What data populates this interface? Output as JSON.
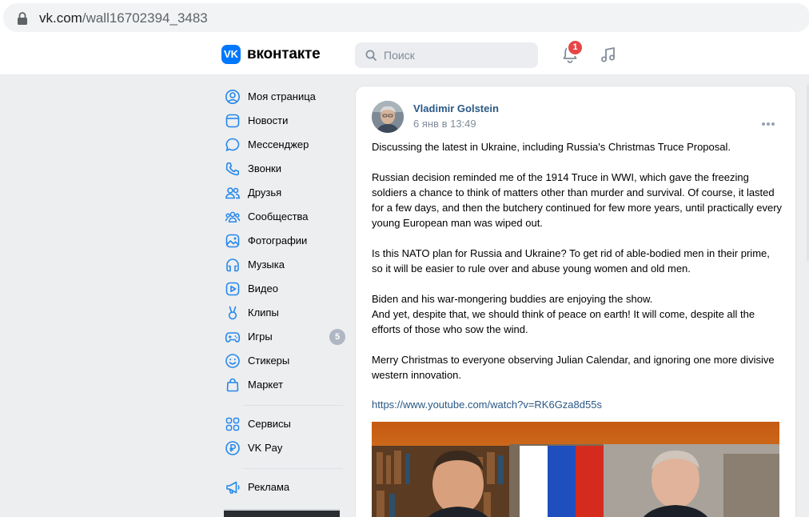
{
  "browser": {
    "url_host": "vk.com",
    "url_path": "/wall16702394_3483",
    "lock_icon": "lock-icon"
  },
  "header": {
    "logo_mark": "VK",
    "site_name": "вконтакте",
    "search_placeholder": "Поиск",
    "notifications_count": "1",
    "accent": "#0077ff",
    "badge_color": "#e64646"
  },
  "sidebar": {
    "items": [
      {
        "label": "Моя страница",
        "icon": "user-circle-icon"
      },
      {
        "label": "Новости",
        "icon": "news-icon"
      },
      {
        "label": "Мессенджер",
        "icon": "message-icon"
      },
      {
        "label": "Звонки",
        "icon": "phone-icon"
      },
      {
        "label": "Друзья",
        "icon": "friends-icon"
      },
      {
        "label": "Сообщества",
        "icon": "communities-icon"
      },
      {
        "label": "Фотографии",
        "icon": "photo-icon"
      },
      {
        "label": "Музыка",
        "icon": "music-icon"
      },
      {
        "label": "Видео",
        "icon": "video-icon"
      },
      {
        "label": "Клипы",
        "icon": "clips-icon"
      },
      {
        "label": "Игры",
        "icon": "games-icon",
        "count": "5"
      },
      {
        "label": "Стикеры",
        "icon": "smile-icon"
      },
      {
        "label": "Маркет",
        "icon": "market-bag-icon"
      }
    ],
    "items2": [
      {
        "label": "Сервисы",
        "icon": "services-grid-icon"
      },
      {
        "label": "VK Pay",
        "icon": "vkpay-icon"
      }
    ],
    "items3": [
      {
        "label": "Реклама",
        "icon": "megaphone-icon"
      }
    ]
  },
  "post": {
    "author": "Vladimir Golstein",
    "date": "6 янв в 13:49",
    "paragraphs": [
      "Discussing the latest in Ukraine, including Russia's Christmas Truce Proposal.",
      "Russian decision reminded me of the 1914 Truce in WWI, which gave the freezing soldiers a chance to think of matters other than murder and survival. Of course, it lasted for a few days, and then the butchery continued for few more years, until practically every young European man was wiped out.",
      "Is this NATO plan for Russia and Ukraine? To get rid of able-bodied men in their prime, so it will be easier to rule over and abuse young women and old men.",
      "Biden and his war-mongering buddies are enjoying the show.",
      "And yet, despite that, we should think of peace on earth! It will come, despite all the efforts of those who sow the wind.",
      "Merry Christmas to everyone observing Julian Calendar, and ignoring one more divisive western innovation."
    ],
    "link": "https://www.youtube.com/watch?v=RK6Gza8d55s",
    "link_color": "#2a5885"
  }
}
